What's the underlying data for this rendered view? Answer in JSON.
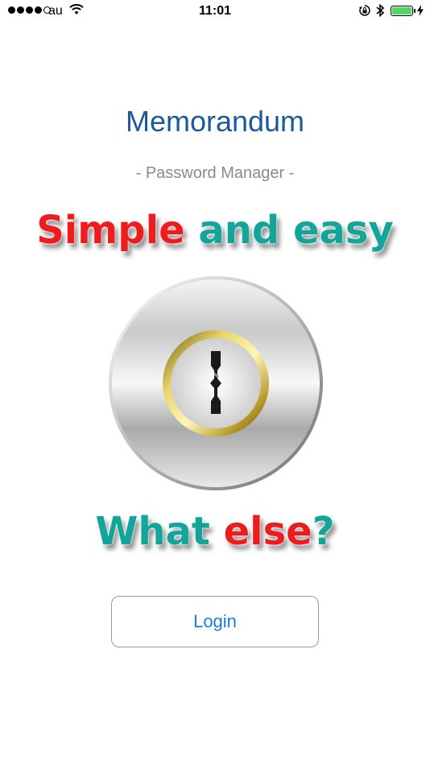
{
  "status_bar": {
    "carrier": "au",
    "time": "11:01",
    "signal_bars": 4,
    "battery_fill_fraction": 1.0
  },
  "app": {
    "title": "Memorandum",
    "subtitle": "- Password Manager -"
  },
  "slogan_top": {
    "part1": "Simple",
    "part2": " and easy"
  },
  "slogan_bottom": {
    "part1": "What ",
    "part2": "else",
    "part3": "?"
  },
  "login": {
    "label": "Login"
  },
  "colors": {
    "title": "#1a5a9a",
    "red": "#ee1c1c",
    "teal": "#14a59a",
    "button_text": "#1a7ee0",
    "battery": "#4cd964"
  },
  "icons": [
    "wifi-icon",
    "rotation-lock-icon",
    "bluetooth-icon",
    "battery-icon",
    "charging-bolt-icon",
    "lock-icon"
  ]
}
